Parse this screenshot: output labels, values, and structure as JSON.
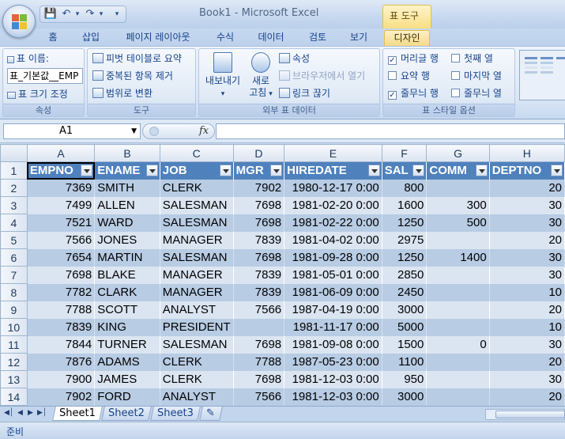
{
  "window": {
    "title": "Book1 - Microsoft Excel",
    "context_tab_group": "표 도구"
  },
  "qat": {
    "save_icon": "save-icon",
    "undo_icon": "undo-icon",
    "redo_icon": "redo-icon",
    "more_icon": "chevron-down-icon"
  },
  "tabs": [
    {
      "label": "홈"
    },
    {
      "label": "삽입"
    },
    {
      "label": "페이지 레이아웃"
    },
    {
      "label": "수식"
    },
    {
      "label": "데이터"
    },
    {
      "label": "검토"
    },
    {
      "label": "보기"
    },
    {
      "label": "디자인",
      "active": true
    }
  ],
  "ribbon": {
    "properties": {
      "title": "속성",
      "name_label": "표 이름:",
      "name_value": "표_기본값__EMP",
      "resize": "표 크기 조정"
    },
    "tools": {
      "title": "도구",
      "pivot": "피벗 테이블로 요약",
      "dedupe": "중복된 항목 제거",
      "convert": "범위로 변환"
    },
    "external": {
      "title": "외부 표 데이터",
      "export_1": "내보내기",
      "refresh_1": "새로",
      "refresh_2": "고침",
      "properties": "속성",
      "open_browser": "브라우저에서 열기",
      "unlink": "링크 끊기"
    },
    "style_options": {
      "title": "표 스타일 옵션",
      "header_row": "머리글 행",
      "total_row": "요약 행",
      "banded_rows": "줄무늬 행",
      "first_column": "첫째 열",
      "last_column": "마지막 열",
      "banded_columns": "줄무늬 열"
    }
  },
  "formula_bar": {
    "name_box": "A1",
    "fx": "fx",
    "formula": ""
  },
  "grid": {
    "col_headers": [
      "A",
      "B",
      "C",
      "D",
      "E",
      "F",
      "G",
      "H"
    ],
    "field_headers": [
      "EMPNO",
      "ENAME",
      "JOB",
      "MGR",
      "HIREDATE",
      "SAL",
      "COMM",
      "DEPTNO"
    ],
    "rows": [
      {
        "num": "2",
        "cells": [
          "7369",
          "SMITH",
          "CLERK",
          "7902",
          "1980-12-17 0:00",
          "800",
          "",
          "20"
        ]
      },
      {
        "num": "3",
        "cells": [
          "7499",
          "ALLEN",
          "SALESMAN",
          "7698",
          "1981-02-20 0:00",
          "1600",
          "300",
          "30"
        ]
      },
      {
        "num": "4",
        "cells": [
          "7521",
          "WARD",
          "SALESMAN",
          "7698",
          "1981-02-22 0:00",
          "1250",
          "500",
          "30"
        ]
      },
      {
        "num": "5",
        "cells": [
          "7566",
          "JONES",
          "MANAGER",
          "7839",
          "1981-04-02 0:00",
          "2975",
          "",
          "20"
        ]
      },
      {
        "num": "6",
        "cells": [
          "7654",
          "MARTIN",
          "SALESMAN",
          "7698",
          "1981-09-28 0:00",
          "1250",
          "1400",
          "30"
        ]
      },
      {
        "num": "7",
        "cells": [
          "7698",
          "BLAKE",
          "MANAGER",
          "7839",
          "1981-05-01 0:00",
          "2850",
          "",
          "30"
        ]
      },
      {
        "num": "8",
        "cells": [
          "7782",
          "CLARK",
          "MANAGER",
          "7839",
          "1981-06-09 0:00",
          "2450",
          "",
          "10"
        ]
      },
      {
        "num": "9",
        "cells": [
          "7788",
          "SCOTT",
          "ANALYST",
          "7566",
          "1987-04-19 0:00",
          "3000",
          "",
          "20"
        ]
      },
      {
        "num": "10",
        "cells": [
          "7839",
          "KING",
          "PRESIDENT",
          "",
          "1981-11-17 0:00",
          "5000",
          "",
          "10"
        ]
      },
      {
        "num": "11",
        "cells": [
          "7844",
          "TURNER",
          "SALESMAN",
          "7698",
          "1981-09-08 0:00",
          "1500",
          "0",
          "30"
        ]
      },
      {
        "num": "12",
        "cells": [
          "7876",
          "ADAMS",
          "CLERK",
          "7788",
          "1987-05-23 0:00",
          "1100",
          "",
          "20"
        ]
      },
      {
        "num": "13",
        "cells": [
          "7900",
          "JAMES",
          "CLERK",
          "7698",
          "1981-12-03 0:00",
          "950",
          "",
          "30"
        ]
      },
      {
        "num": "14",
        "cells": [
          "7902",
          "FORD",
          "ANALYST",
          "7566",
          "1981-12-03 0:00",
          "3000",
          "",
          "20"
        ]
      }
    ]
  },
  "sheet_tabs": [
    "Sheet1",
    "Sheet2",
    "Sheet3"
  ],
  "status": {
    "ready": "준비"
  },
  "colors": {
    "table_header": "#4f81bd",
    "band_dark": "#b8cce4",
    "band_light": "#dbe5f1",
    "accent_tab": "#f5da86"
  }
}
